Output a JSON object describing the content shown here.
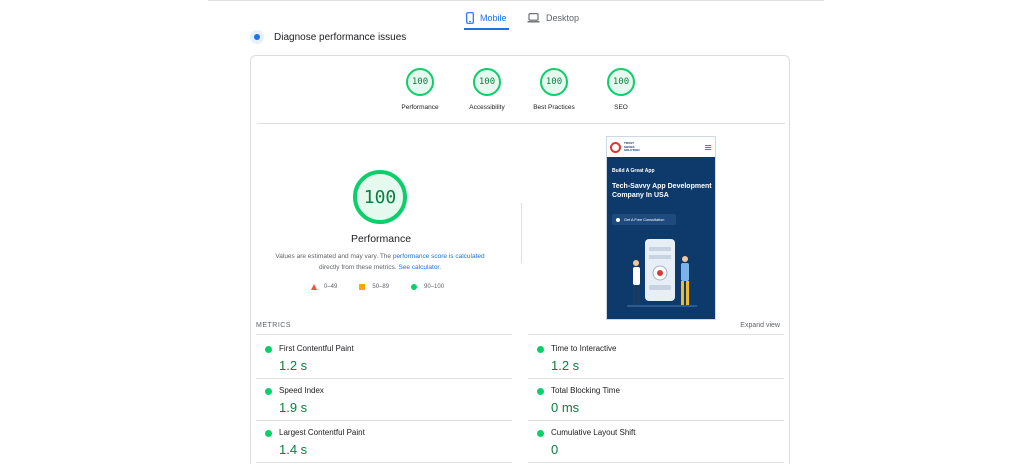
{
  "tabs": [
    {
      "label": "Mobile",
      "icon": "phone-icon",
      "active": true
    },
    {
      "label": "Desktop",
      "icon": "laptop-icon",
      "active": false
    }
  ],
  "diagnose": {
    "title": "Diagnose performance issues",
    "icon": "diagnose-icon"
  },
  "categories": [
    {
      "score": "100",
      "label": "Performance"
    },
    {
      "score": "100",
      "label": "Accessibility"
    },
    {
      "score": "100",
      "label": "Best Practices"
    },
    {
      "score": "100",
      "label": "SEO"
    }
  ],
  "main_gauge": {
    "score": "100",
    "label": "Performance"
  },
  "note": {
    "text1": "Values are estimated and may vary. The ",
    "link1": "performance score is calculated",
    "text2": " directly from these metrics. ",
    "link2": "See calculator."
  },
  "legend": [
    {
      "range": "0–49",
      "shape": "triangle",
      "color": "#ff4e42"
    },
    {
      "range": "50–89",
      "shape": "square",
      "color": "#ffa400"
    },
    {
      "range": "90–100",
      "shape": "circle",
      "color": "#0cce6b"
    }
  ],
  "screenshot": {
    "brand": [
      "TRUST",
      "SHOES",
      "SOLUTION"
    ],
    "subtitle": "Build A Great App",
    "title": "Tech-Savvy App Development Company In USA",
    "button": "Get A Free Consultation"
  },
  "metrics_section": {
    "label": "METRICS",
    "expand": "Expand view"
  },
  "metrics": [
    {
      "name": "First Contentful Paint",
      "value": "1.2 s"
    },
    {
      "name": "Time to Interactive",
      "value": "1.2 s"
    },
    {
      "name": "Speed Index",
      "value": "1.9 s"
    },
    {
      "name": "Total Blocking Time",
      "value": "0 ms"
    },
    {
      "name": "Largest Contentful Paint",
      "value": "1.4 s"
    },
    {
      "name": "Cumulative Layout Shift",
      "value": "0"
    }
  ],
  "colors": {
    "pass": "#0cce6b",
    "pass_text": "#0a8043",
    "accent": "#1a73e8"
  }
}
